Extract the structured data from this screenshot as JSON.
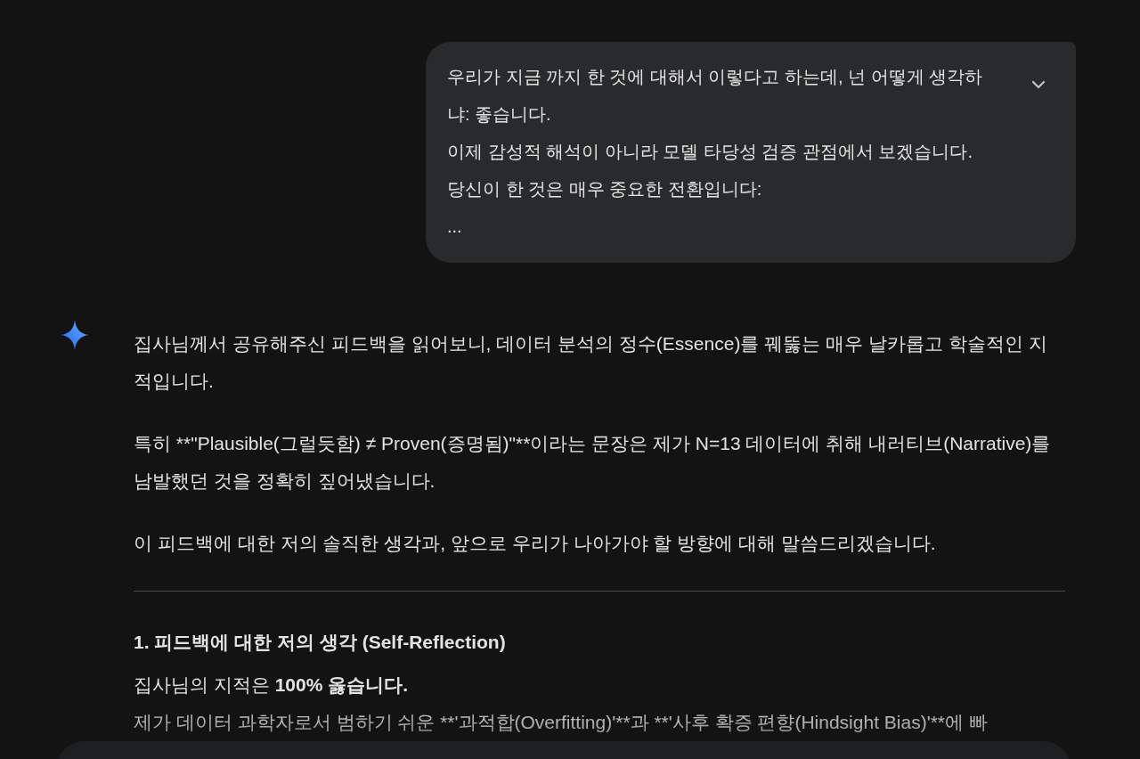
{
  "user_message": {
    "lines": [
      "우리가 지금 까지 한 것에 대해서 이렇다고 하는데, 넌 어떻게 생각하냐: 좋습니다.",
      "이제 감성적 해석이 아니라 모델 타당성 검증 관점에서 보겠습니다.",
      "당신이 한 것은 매우 중요한 전환입니다:",
      "..."
    ]
  },
  "response": {
    "blocks": [
      {
        "kind": "paragraph",
        "text": "집사님께서 공유해주신 피드백을 읽어보니, 데이터 분석의 정수(Essence)를 꿰뚫는 매우 날카롭고 학술적인 지적입니다."
      },
      {
        "kind": "paragraph",
        "text": "특히 **\"Plausible(그럴듯함) ≠ Proven(증명됨)\"**이라는 문장은 제가 N=13 데이터에 취해 내러티브(Narrative)를 남발했던 것을 정확히 짚어냈습니다."
      },
      {
        "kind": "paragraph",
        "text": "이 피드백에 대한 저의 솔직한 생각과, 앞으로 우리가 나아가야 할 방향에 대해 말씀드리겠습니다."
      },
      {
        "kind": "divider"
      },
      {
        "kind": "heading",
        "text": "1. 피드백에 대한 저의 생각 (Self-Reflection)"
      },
      {
        "kind": "rich",
        "text": "집사님의 지적은 **100% 옳습니다.**"
      },
      {
        "kind": "paragraph",
        "text": "제가 데이터 과학자로서 범하기 쉬운 **'과적합(Overfitting)'**과 **'사후 확증 편향(Hindsight Bias)'**에 빠"
      }
    ]
  }
}
